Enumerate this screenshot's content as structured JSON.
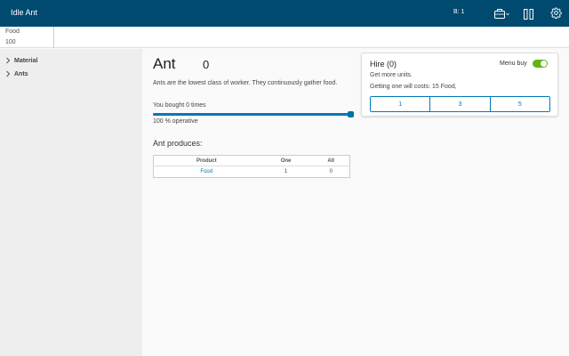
{
  "app": {
    "title": "Idle Ant"
  },
  "header": {
    "badge": "B: 1",
    "icons": [
      "briefcase-icon",
      "pause-icon",
      "gear-icon"
    ]
  },
  "resources": [
    {
      "name": "Food",
      "value": "100"
    }
  ],
  "sidebar": {
    "items": [
      {
        "label": "Material"
      },
      {
        "label": "Ants"
      }
    ]
  },
  "main": {
    "title": "Ant",
    "count": "0",
    "description": "Ants are the lowest class of worker. They continuously gather food.",
    "bought": "You bought 0 times",
    "operative_text": "100 % operative",
    "operative_fraction": 1.0,
    "produces_title": "Ant produces:",
    "table": {
      "headers": [
        "Product",
        "One",
        "All"
      ],
      "rows": [
        {
          "product": "Food",
          "one": "1",
          "all": "0"
        }
      ]
    }
  },
  "hire": {
    "title": "Hire (0)",
    "menu_buy_label": "Menu buy",
    "menu_buy_on": true,
    "subtitle": "Get more units.",
    "cost": "Getting one will costs: 15 Food,",
    "buttons": [
      "1",
      "3",
      "5"
    ]
  },
  "colors": {
    "header_bg": "#004a70",
    "accent": "#0079b8",
    "toggle_on": "#60b515"
  }
}
